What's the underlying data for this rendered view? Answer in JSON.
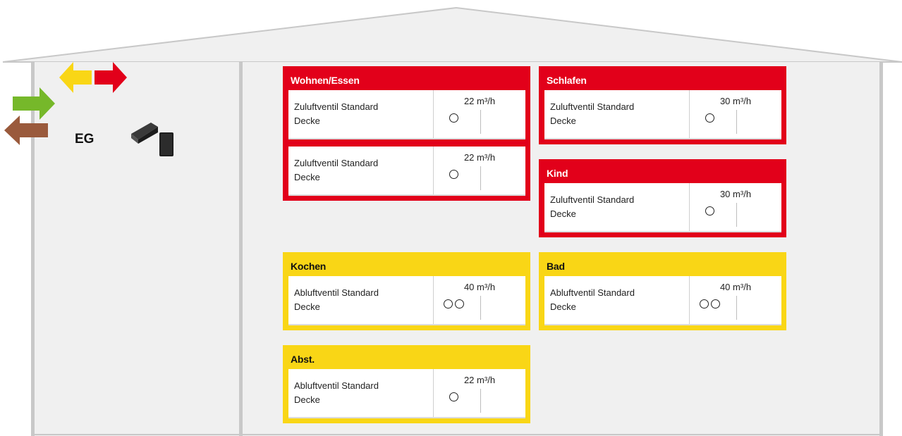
{
  "floor": {
    "label": "EG"
  },
  "colors": {
    "supply": "#e2001a",
    "extract": "#f9d616",
    "outdoor_air": "#76b82a",
    "exhaust_air": "#9a5a3c",
    "wall": "#c8c8c8",
    "floor_fill": "#f0f0f0"
  },
  "icons": {
    "ventilation_unit": "ventilation-unit-icon",
    "supply_arrow": "arrow-right-red",
    "extract_arrow": "arrow-left-yellow",
    "outdoor_arrow": "arrow-right-green",
    "exhaust_arrow": "arrow-left-brown",
    "outlet": "circle-outlet-icon"
  },
  "rooms": [
    {
      "name": "Wohnen/Essen",
      "type": "supply",
      "valves": [
        {
          "description_line1": "Zuluftventil Standard",
          "description_line2": "Decke",
          "flow_value": "22",
          "flow_unit": "m³/h",
          "outlets": 1
        },
        {
          "description_line1": "Zuluftventil Standard",
          "description_line2": "Decke",
          "flow_value": "22",
          "flow_unit": "m³/h",
          "outlets": 1
        }
      ]
    },
    {
      "name": "Schlafen",
      "type": "supply",
      "valves": [
        {
          "description_line1": "Zuluftventil Standard",
          "description_line2": "Decke",
          "flow_value": "30",
          "flow_unit": "m³/h",
          "outlets": 1
        }
      ]
    },
    {
      "name": "Kind",
      "type": "supply",
      "valves": [
        {
          "description_line1": "Zuluftventil Standard",
          "description_line2": "Decke",
          "flow_value": "30",
          "flow_unit": "m³/h",
          "outlets": 1
        }
      ]
    },
    {
      "name": "Kochen",
      "type": "extract",
      "valves": [
        {
          "description_line1": "Abluftventil Standard",
          "description_line2": "Decke",
          "flow_value": "40",
          "flow_unit": "m³/h",
          "outlets": 2
        }
      ]
    },
    {
      "name": "Bad",
      "type": "extract",
      "valves": [
        {
          "description_line1": "Abluftventil Standard",
          "description_line2": "Decke",
          "flow_value": "40",
          "flow_unit": "m³/h",
          "outlets": 2
        }
      ]
    },
    {
      "name": "Abst.",
      "type": "extract",
      "valves": [
        {
          "description_line1": "Abluftventil Standard",
          "description_line2": "Decke",
          "flow_value": "22",
          "flow_unit": "m³/h",
          "outlets": 1
        }
      ]
    }
  ]
}
